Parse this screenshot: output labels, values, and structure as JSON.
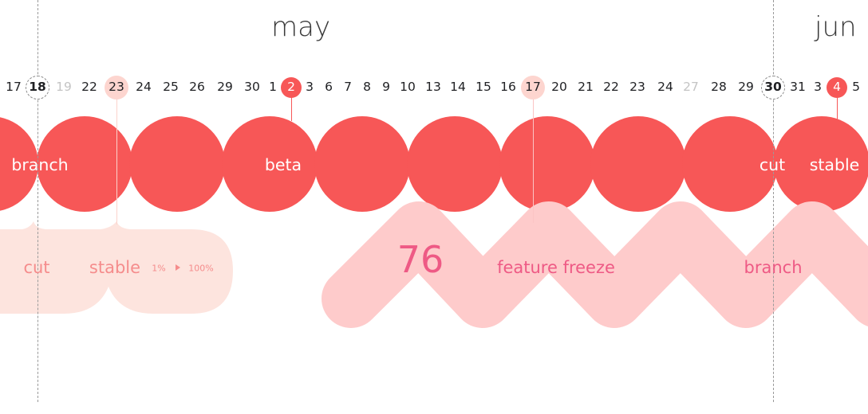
{
  "colors": {
    "main": "#f75757",
    "pale_band": "#fde4de",
    "pink_band": "#fecbcb",
    "pink_text": "#ee5a85",
    "pale_text": "#f58c8c"
  },
  "months": [
    {
      "label": "may"
    },
    {
      "label": "jun"
    }
  ],
  "days": [
    {
      "label": "17",
      "style": "normal"
    },
    {
      "label": "18",
      "style": "dashed-bold"
    },
    {
      "label": "19",
      "style": "dim"
    },
    {
      "label": "22",
      "style": "normal"
    },
    {
      "label": "23",
      "style": "soft"
    },
    {
      "label": "24",
      "style": "normal"
    },
    {
      "label": "25",
      "style": "normal"
    },
    {
      "label": "26",
      "style": "normal"
    },
    {
      "label": "29",
      "style": "normal"
    },
    {
      "label": "30",
      "style": "normal"
    },
    {
      "label": "1",
      "style": "normal"
    },
    {
      "label": "2",
      "style": "solid"
    },
    {
      "label": "3",
      "style": "normal"
    },
    {
      "label": "6",
      "style": "normal"
    },
    {
      "label": "7",
      "style": "normal"
    },
    {
      "label": "8",
      "style": "normal"
    },
    {
      "label": "9",
      "style": "normal"
    },
    {
      "label": "10",
      "style": "normal"
    },
    {
      "label": "13",
      "style": "normal"
    },
    {
      "label": "14",
      "style": "normal"
    },
    {
      "label": "15",
      "style": "normal"
    },
    {
      "label": "16",
      "style": "normal"
    },
    {
      "label": "17",
      "style": "soft"
    },
    {
      "label": "20",
      "style": "normal"
    },
    {
      "label": "21",
      "style": "normal"
    },
    {
      "label": "22",
      "style": "normal"
    },
    {
      "label": "23",
      "style": "normal"
    },
    {
      "label": "24",
      "style": "normal"
    },
    {
      "label": "27",
      "style": "dim"
    },
    {
      "label": "28",
      "style": "normal"
    },
    {
      "label": "29",
      "style": "normal"
    },
    {
      "label": "30",
      "style": "dashed-bold"
    },
    {
      "label": "31",
      "style": "normal"
    },
    {
      "label": "3",
      "style": "normal"
    },
    {
      "label": "4",
      "style": "solid"
    },
    {
      "label": "5",
      "style": "normal"
    }
  ],
  "main_track": {
    "labels": [
      {
        "text": "branch"
      },
      {
        "text": "beta"
      },
      {
        "text": "cut"
      },
      {
        "text": "stable"
      }
    ]
  },
  "previous_release": {
    "labels": [
      {
        "text": "cut"
      },
      {
        "text": "stable"
      }
    ],
    "rollout": {
      "from": "1%",
      "to": "100%"
    }
  },
  "next_release": {
    "version": "76",
    "labels": [
      {
        "text": "feature freeze"
      },
      {
        "text": "branch"
      }
    ]
  }
}
